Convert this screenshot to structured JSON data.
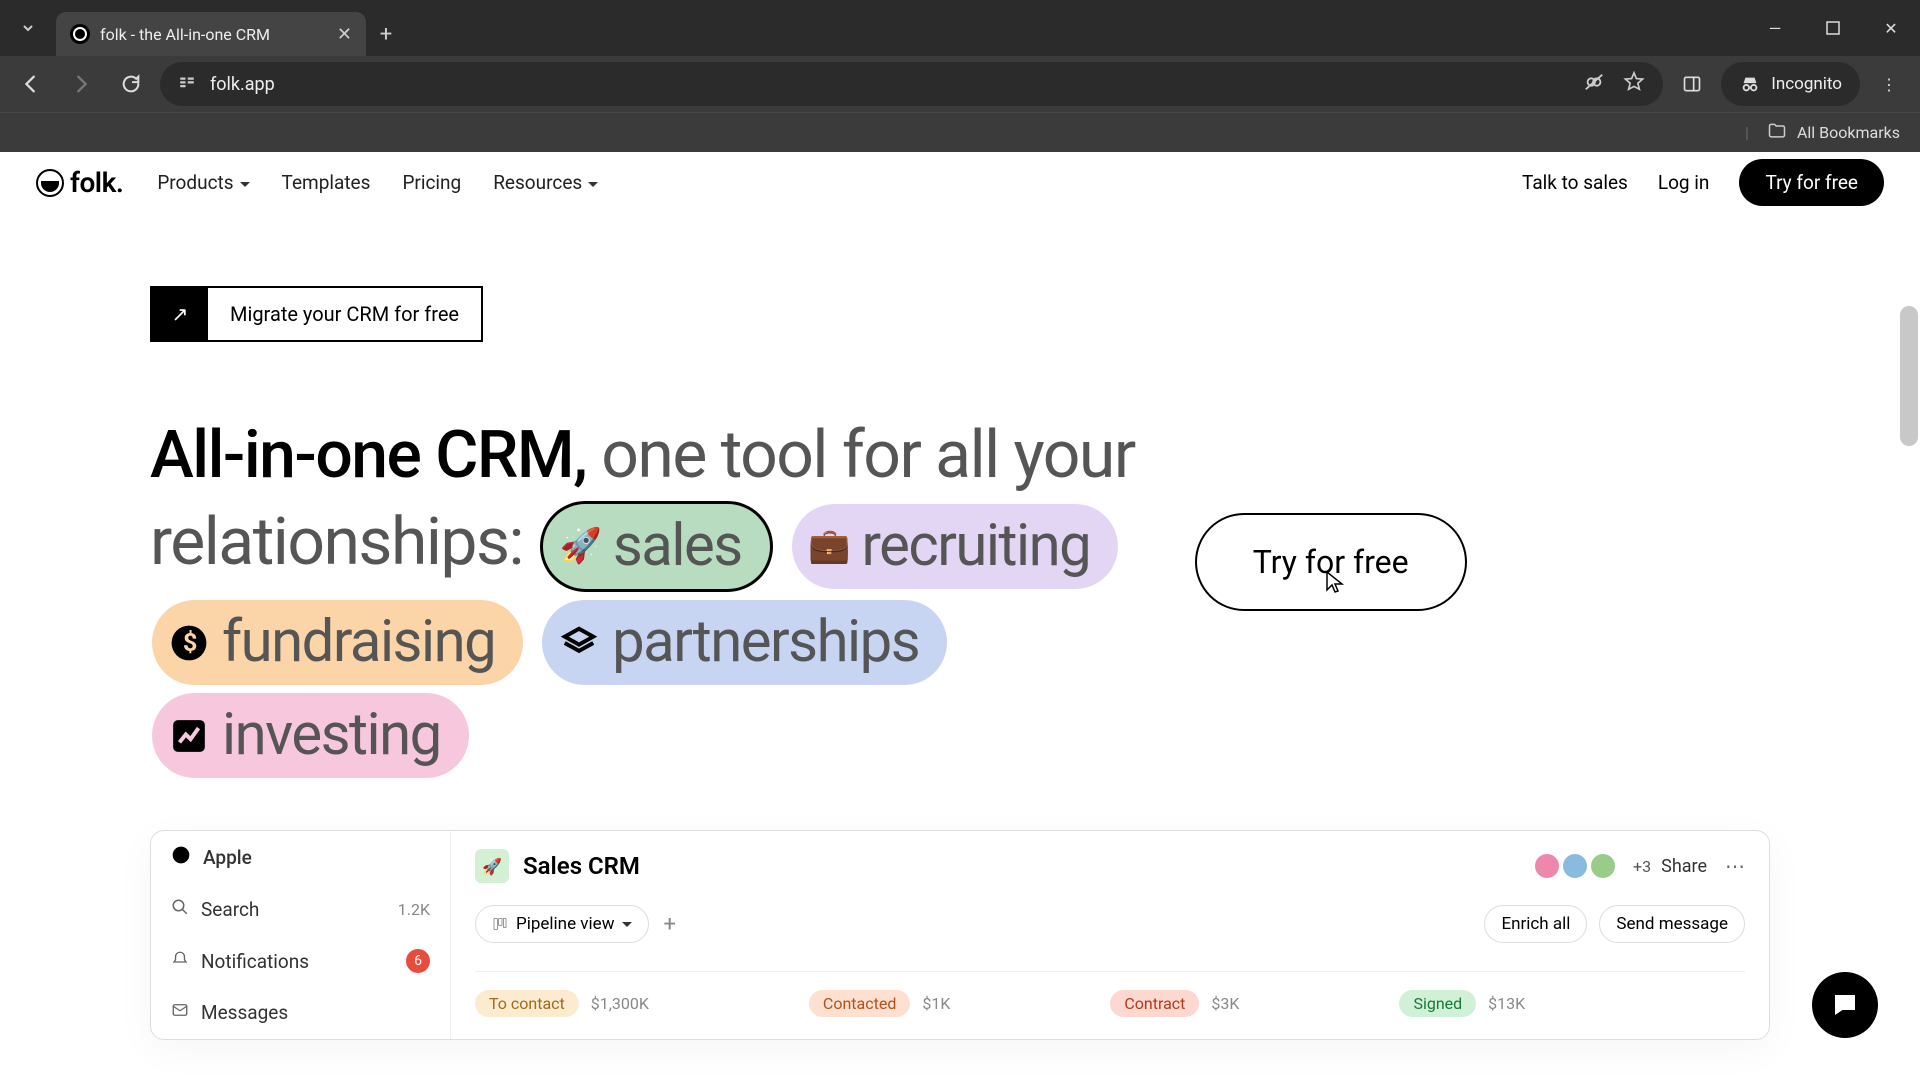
{
  "browser": {
    "tab_title": "folk - the All-in-one CRM",
    "url": "folk.app",
    "incognito_label": "Incognito",
    "all_bookmarks": "All Bookmarks"
  },
  "header": {
    "logo_text": "folk.",
    "nav": {
      "products": "Products",
      "templates": "Templates",
      "pricing": "Pricing",
      "resources": "Resources"
    },
    "talk_to_sales": "Talk to sales",
    "login": "Log in",
    "try_for_free": "Try for free"
  },
  "hero": {
    "migrate_label": "Migrate your CRM for free",
    "headline_strong": "All-in-one CRM,",
    "headline_rest_1": " one tool for all your",
    "headline_rest_2": "relationships: ",
    "pills": {
      "sales": "sales",
      "recruiting": "recruiting",
      "fundraising": "fundraising",
      "partnerships": "partnerships",
      "investing": "investing"
    },
    "try_for_free": "Try for free"
  },
  "preview": {
    "brand": "Apple",
    "search_label": "Search",
    "search_meta": "1.2K",
    "notifications_label": "Notifications",
    "notifications_badge": "6",
    "messages_label": "Messages",
    "title": "Sales CRM",
    "plus_count": "+3",
    "share": "Share",
    "pipeline_view": "Pipeline view",
    "enrich_all": "Enrich all",
    "send_message": "Send message",
    "stages": [
      {
        "name": "To contact",
        "amount": "$1,300K"
      },
      {
        "name": "Contacted",
        "amount": "$1K"
      },
      {
        "name": "Contract",
        "amount": "$3K"
      },
      {
        "name": "Signed",
        "amount": "$13K"
      }
    ]
  }
}
